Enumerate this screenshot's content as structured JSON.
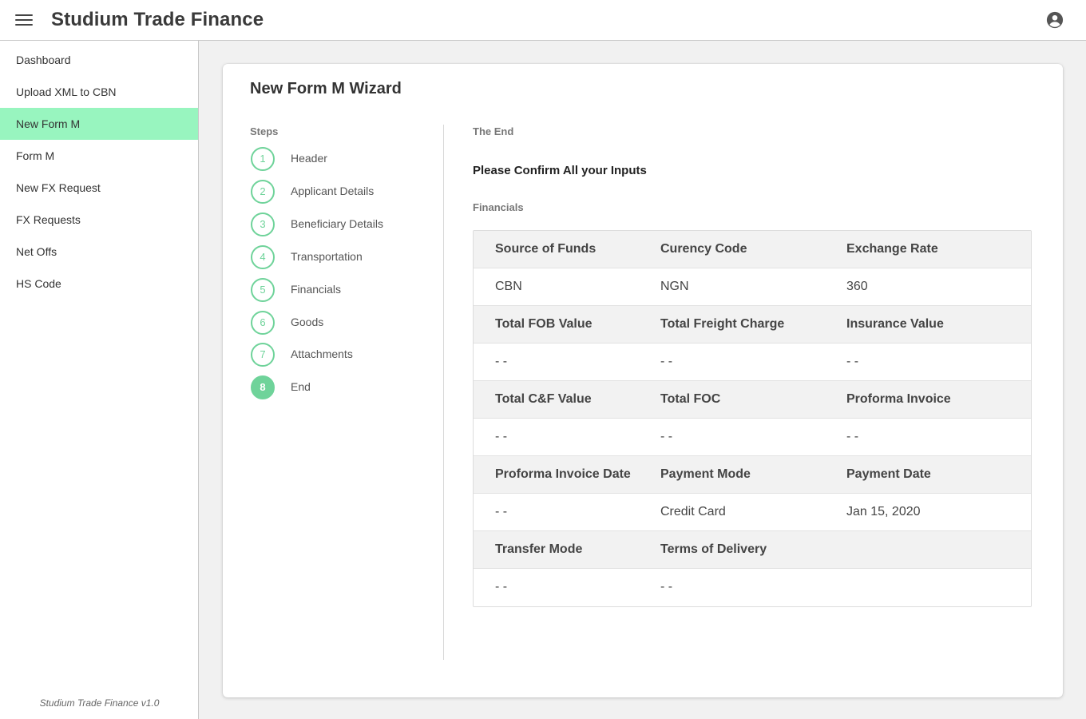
{
  "app": {
    "title": "Studium Trade Finance",
    "menu_icon": "hamburger-menu-icon",
    "account_icon": "account-circle-icon"
  },
  "sidebar": {
    "items": [
      {
        "label": "Dashboard"
      },
      {
        "label": "Upload XML to CBN"
      },
      {
        "label": "New Form M",
        "active": true
      },
      {
        "label": "Form M"
      },
      {
        "label": "New FX Request"
      },
      {
        "label": "FX Requests"
      },
      {
        "label": "Net Offs"
      },
      {
        "label": "HS Code"
      }
    ],
    "version": "Studium Trade Finance v1.0",
    "active_color": "#98f5bf"
  },
  "wizard": {
    "title": "New Form M Wizard",
    "steps_label": "Steps",
    "steps": [
      {
        "number": "1",
        "label": "Header"
      },
      {
        "number": "2",
        "label": "Applicant Details"
      },
      {
        "number": "3",
        "label": "Beneficiary Details"
      },
      {
        "number": "4",
        "label": "Transportation"
      },
      {
        "number": "5",
        "label": "Financials"
      },
      {
        "number": "6",
        "label": "Goods"
      },
      {
        "number": "7",
        "label": "Attachments"
      },
      {
        "number": "8",
        "label": "End",
        "current": true
      }
    ],
    "accent_color": "#6fd39a"
  },
  "end_section": {
    "title": "The End",
    "confirm_text": "Please Confirm All your Inputs",
    "group_title": "Financials",
    "rows": [
      {
        "headers": [
          "Source of Funds",
          "Curency Code",
          "Exchange Rate"
        ],
        "values": [
          "CBN",
          "NGN",
          "360"
        ]
      },
      {
        "headers": [
          "Total FOB Value",
          "Total Freight Charge",
          "Insurance Value"
        ],
        "values": [
          "- -",
          "- -",
          "- -"
        ]
      },
      {
        "headers": [
          "Total C&F Value",
          "Total FOC",
          "Proforma Invoice"
        ],
        "values": [
          "- -",
          "- -",
          "- -"
        ]
      },
      {
        "headers": [
          "Proforma Invoice Date",
          "Payment Mode",
          "Payment Date"
        ],
        "values": [
          "- -",
          "Credit Card",
          "Jan 15, 2020"
        ]
      },
      {
        "headers": [
          "Transfer Mode",
          "Terms of Delivery",
          ""
        ],
        "values": [
          "- -",
          "- -",
          ""
        ]
      }
    ]
  }
}
